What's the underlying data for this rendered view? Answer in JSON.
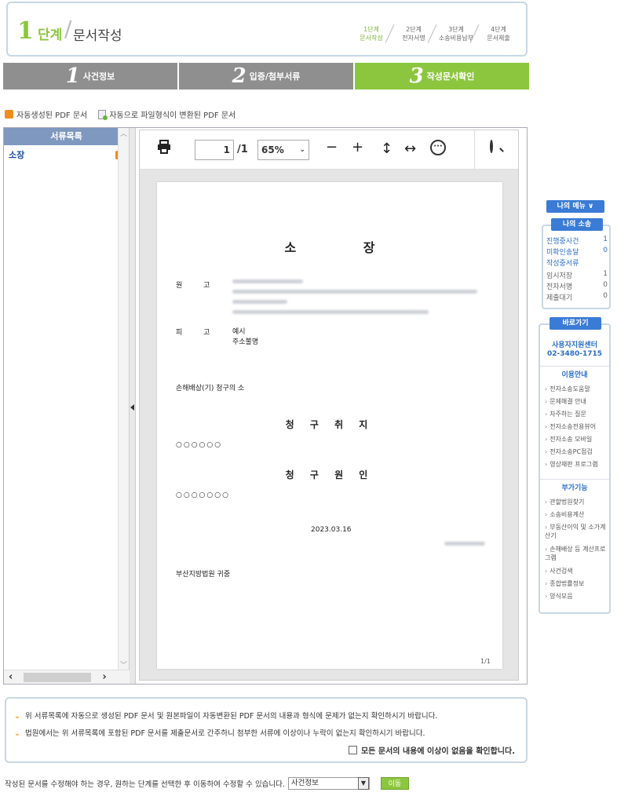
{
  "header": {
    "step_num": "1",
    "step_word": "단계",
    "step_title": "문서작성",
    "steps": [
      {
        "line1": "1단계",
        "line2": "문서작성",
        "active": true
      },
      {
        "line1": "2단계",
        "line2": "전자서명",
        "active": false
      },
      {
        "line1": "3단계",
        "line2": "소송비용납부",
        "active": false
      },
      {
        "line1": "4단계",
        "line2": "문서제출",
        "active": false
      }
    ]
  },
  "tabs": [
    {
      "num": "1",
      "label": "사건정보"
    },
    {
      "num": "2",
      "label": "입증/첨부서류"
    },
    {
      "num": "3",
      "label": "작성문서확인"
    }
  ],
  "legend": {
    "auto_pdf": "자동생성된 PDF 문서",
    "converted_pdf": "자동으로 파일형식이 변환된 PDF 문서"
  },
  "doc_list": {
    "header": "서류목록",
    "items": [
      {
        "label": "소장"
      }
    ]
  },
  "viewer": {
    "page_current": "1",
    "page_total": "/1",
    "zoom": "65%"
  },
  "document": {
    "title": "소  장",
    "plaintiff_label": "원 고",
    "defendant_label": "피 고",
    "defendant_name": "예시",
    "defendant_addr": "주소불명",
    "case_name": "손해배상(기) 청구의 소",
    "claim_purpose_title": "청 구 취 지",
    "claim_purpose_body": "○○○○○○",
    "claim_cause_title": "청 구 원 인",
    "claim_cause_body": "○○○○○○○",
    "date": "2023.03.16",
    "court": "부산지방법원 귀중",
    "page_no": "1/1"
  },
  "confirm": {
    "line1": "위 서류목록에 자동으로 생성된 PDF 문서 및 원본파일이 자동변환된 PDF 문서의 내용과 형식에 문제가 없는지 확인하시기 바랍니다.",
    "line2": "법원에서는 위 서류목록에 포함된 PDF 문서를 제출문서로 간주하니 첨부한 서류에 이상이나 누락이 없는지 확인하시기 바랍니다.",
    "checkbox_label": "모든 문서의 내용에 이상이 없음을 확인합니다."
  },
  "bottom": {
    "text": "작성된 문서를 수정해야 하는 경우, 원하는 단계를 선택한 후 이동하여 수정할 수 있습니다.",
    "select_value": "사건정보",
    "go_label": "이동"
  },
  "sidebar": {
    "menu_button": "나의 메뉴 ∨",
    "my_case_head": "나의 소송",
    "my_case_rows": [
      {
        "label": "진행중사건",
        "value": "1",
        "style": "blue"
      },
      {
        "label": "미확인송달",
        "value": "0",
        "style": "blue"
      },
      {
        "label": "작성중서류",
        "value": "",
        "style": "blue"
      },
      {
        "label": "임시저장",
        "value": "1",
        "style": "gray"
      },
      {
        "label": "전자서명",
        "value": "0",
        "style": "gray"
      },
      {
        "label": "제출대기",
        "value": "0",
        "style": "gray"
      }
    ],
    "shortcut_head": "바로가기",
    "support_center": "사용자지원센터",
    "support_phone": "02-3480-1715",
    "usage_head": "이용안내",
    "usage_links": [
      "전자소송도움말",
      "문제해결 안내",
      "자주하는 질문",
      "전자소송전용뷰어",
      "전자소송 모바일",
      "전자소송PC점검",
      "영상재판 프로그램"
    ],
    "extra_head": "부가기능",
    "extra_links": [
      "관할법원찾기",
      "소송비용계산",
      "부동산이익 및 소가계산기",
      "손해배상 등 계산프로그램",
      "사건검색",
      "종합법률정보",
      "양식모음"
    ]
  }
}
